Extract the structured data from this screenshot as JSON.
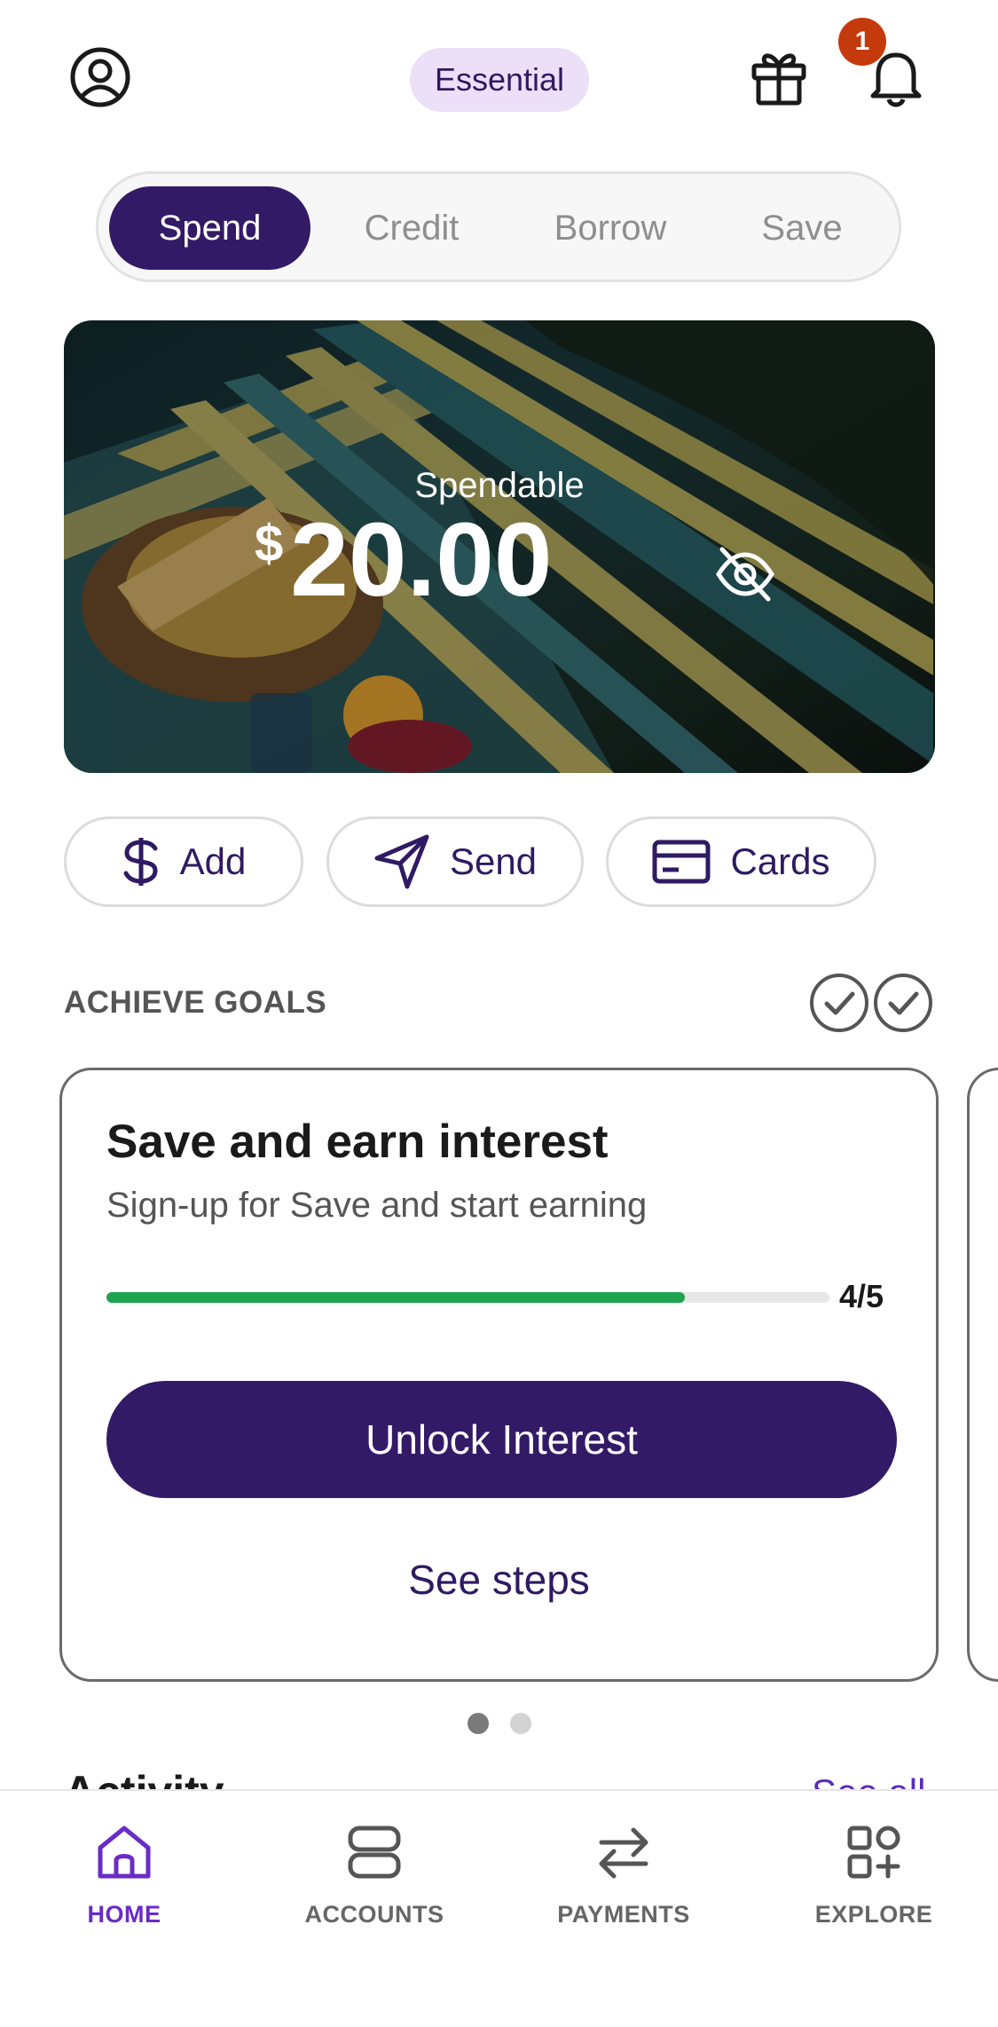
{
  "header": {
    "plan_badge": "Essential",
    "notification_count": "1",
    "icons": [
      "profile-icon",
      "gift-icon",
      "bell-icon"
    ]
  },
  "tabs": [
    {
      "label": "Spend",
      "active": true
    },
    {
      "label": "Credit",
      "active": false
    },
    {
      "label": "Borrow",
      "active": false
    },
    {
      "label": "Save",
      "active": false
    }
  ],
  "balance": {
    "label": "Spendable",
    "currency": "$",
    "amount": "20.00",
    "visibility_icon": "eye-off-icon"
  },
  "actions": [
    {
      "label": "Add",
      "icon": "dollar-icon"
    },
    {
      "label": "Send",
      "icon": "send-icon"
    },
    {
      "label": "Cards",
      "icon": "card-icon"
    }
  ],
  "goals": {
    "section_title": "ACHIEVE GOALS",
    "card": {
      "title": "Save and earn interest",
      "subtitle": "Sign-up for Save and start earning",
      "progress_text": "4/5",
      "progress_fraction": 0.8,
      "primary_button": "Unlock Interest",
      "secondary_link": "See steps"
    },
    "pager": {
      "count": 2,
      "active_index": 0
    }
  },
  "activity": {
    "title": "Activity",
    "see_all": "See all"
  },
  "bottom_nav": [
    {
      "label": "HOME",
      "icon": "home-icon",
      "active": true
    },
    {
      "label": "ACCOUNTS",
      "icon": "accounts-icon",
      "active": false
    },
    {
      "label": "PAYMENTS",
      "icon": "transfer-icon",
      "active": false
    },
    {
      "label": "EXPLORE",
      "icon": "explore-icon",
      "active": false
    }
  ],
  "colors": {
    "brand_purple": "#331a66",
    "accent_purple": "#6a2bc7",
    "progress_green": "#1ea44f",
    "badge_red": "#c53a0c"
  }
}
